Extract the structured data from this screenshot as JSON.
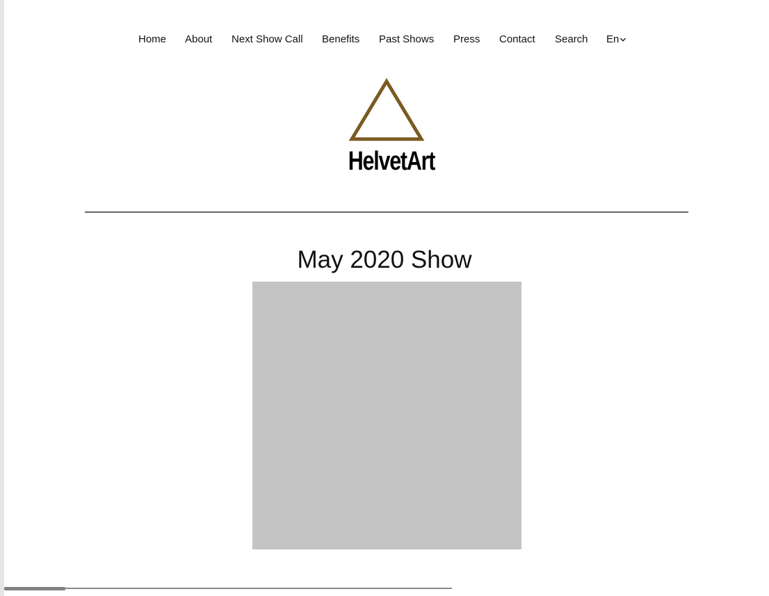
{
  "nav": {
    "items": [
      {
        "label": "Home"
      },
      {
        "label": "About"
      },
      {
        "label": "Next Show Call"
      },
      {
        "label": "Benefits"
      },
      {
        "label": "Past Shows"
      },
      {
        "label": "Press"
      },
      {
        "label": "Contact"
      },
      {
        "label": "Search"
      }
    ],
    "language": {
      "label": "En",
      "icon": "chevron-down-icon"
    }
  },
  "logo": {
    "text": "HelvetArt",
    "icon": "triangle-logo-icon",
    "color": "#7a5a22"
  },
  "main": {
    "title": "May 2020 Show",
    "image_placeholder_color": "#c4c4c4"
  },
  "colors": {
    "divider": "#666666",
    "background": "#ffffff"
  }
}
